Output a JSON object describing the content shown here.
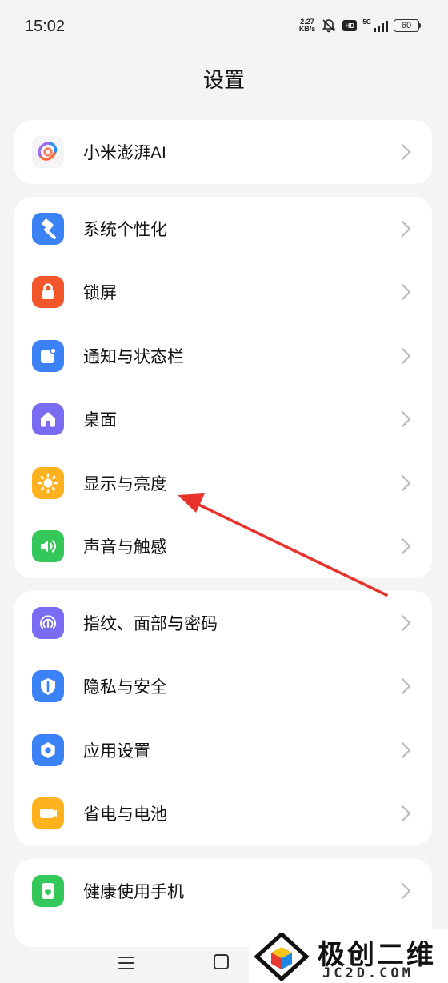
{
  "status_bar": {
    "time": "15:02",
    "net_speed_value": "2.27",
    "net_speed_unit": "KB/s",
    "hd_label": "HD",
    "signal_label": "5G",
    "battery_level": "60"
  },
  "page_title": "设置",
  "groups": [
    {
      "items": [
        {
          "label": "小米澎湃AI",
          "icon": "hyperai-icon"
        }
      ]
    },
    {
      "items": [
        {
          "label": "系统个性化",
          "icon": "paintbrush-icon",
          "color": "#3b82f6"
        },
        {
          "label": "锁屏",
          "icon": "lock-icon",
          "color": "#f2572b"
        },
        {
          "label": "通知与状态栏",
          "icon": "notification-icon",
          "color": "#3b82f6"
        },
        {
          "label": "桌面",
          "icon": "home-icon",
          "color": "#7a6cf2"
        },
        {
          "label": "显示与亮度",
          "icon": "sun-icon",
          "color": "#ffb21e"
        },
        {
          "label": "声音与触感",
          "icon": "speaker-icon",
          "color": "#34c759"
        }
      ]
    },
    {
      "items": [
        {
          "label": "指纹、面部与密码",
          "icon": "fingerprint-icon",
          "color": "#7a6cf2"
        },
        {
          "label": "隐私与安全",
          "icon": "privacy-shield-icon",
          "color": "#3b82f6"
        },
        {
          "label": "应用设置",
          "icon": "app-settings-icon",
          "color": "#3b82f6"
        },
        {
          "label": "省电与电池",
          "icon": "battery-icon",
          "color": "#ffb21e"
        }
      ]
    },
    {
      "items": [
        {
          "label": "健康使用手机",
          "icon": "digital-wellbeing-icon",
          "color": "#34c759"
        }
      ]
    }
  ],
  "watermark": {
    "title": "极创二维",
    "subtitle": "JC2D.COM"
  },
  "annotation": {
    "arrow_color": "#e8322c",
    "points_to": "显示与亮度"
  }
}
